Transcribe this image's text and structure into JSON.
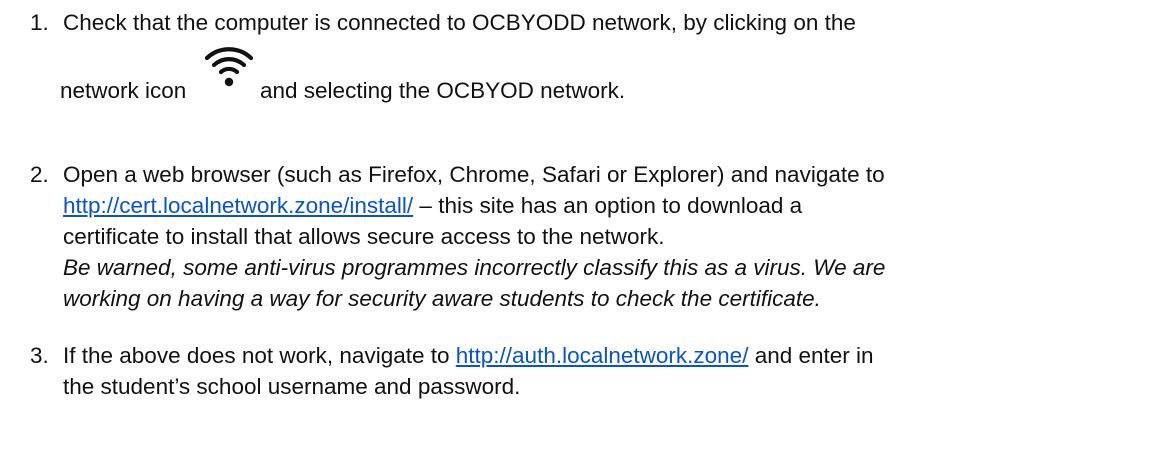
{
  "steps": [
    {
      "number": "1.",
      "line1": "Check that the computer is connected to OCBYODD network, by clicking on the",
      "line2_before_icon": "network icon",
      "icon": "wifi-icon",
      "line2_after_icon": "and selecting the OCBYOD network."
    },
    {
      "number": "2.",
      "line1": "Open a web browser (such as Firefox, Chrome, Safari or Explorer) and navigate to",
      "link": "http://cert.localnetwork.zone/install/",
      "line2_after_link": " – this site has an option to download a",
      "line3": "certificate to install that allows secure access to the network.",
      "warning_line1": "Be warned, some anti-virus programmes incorrectly classify this as a virus. We are",
      "warning_line2": "working on having a way for security aware students to check the certificate."
    },
    {
      "number": "3.",
      "line1_before_link": "If the above does not work, navigate to ",
      "link": "http://auth.localnetwork.zone/",
      "line1_after_link": " and enter in",
      "line2": "the student’s school username and password."
    }
  ],
  "colors": {
    "text": "#111111",
    "link": "#0b53c9"
  }
}
